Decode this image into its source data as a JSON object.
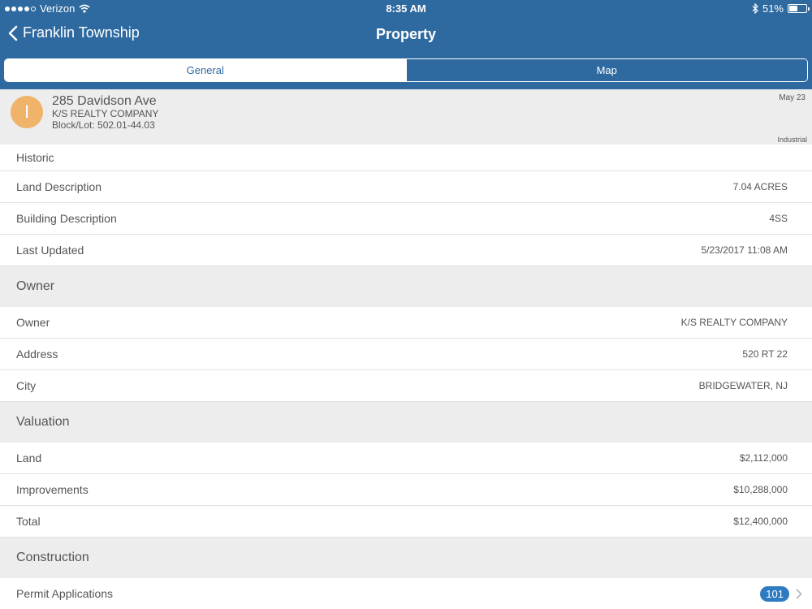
{
  "status_bar": {
    "carrier": "Verizon",
    "time": "8:35 AM",
    "battery": "51%",
    "battery_level": 0.51,
    "wifi_icon": "wifi-icon",
    "bluetooth_icon": "bluetooth-icon"
  },
  "nav": {
    "back_label": "Franklin Township",
    "title": "Property"
  },
  "tabs": [
    {
      "label": "General",
      "active": true
    },
    {
      "label": "Map",
      "active": false
    }
  ],
  "property": {
    "avatar_letter": "I",
    "address": "285 Davidson Ave",
    "owner": "K/S REALTY COMPANY",
    "block_lot": "Block/Lot: 502.01-44.03",
    "date": "May 23",
    "type": "Industrial"
  },
  "general_rows": [
    {
      "label": "Historic",
      "value": ""
    },
    {
      "label": "Land Description",
      "value": "7.04 ACRES"
    },
    {
      "label": "Building Description",
      "value": "4SS"
    },
    {
      "label": "Last Updated",
      "value": "5/23/2017 11:08 AM"
    }
  ],
  "owner_section": {
    "title": "Owner",
    "rows": [
      {
        "label": "Owner",
        "value": "K/S REALTY COMPANY"
      },
      {
        "label": "Address",
        "value": "520 RT 22"
      },
      {
        "label": "City",
        "value": "BRIDGEWATER, NJ"
      }
    ]
  },
  "valuation_section": {
    "title": "Valuation",
    "rows": [
      {
        "label": "Land",
        "value": "$2,112,000"
      },
      {
        "label": "Improvements",
        "value": "$10,288,000"
      },
      {
        "label": "Total",
        "value": "$12,400,000"
      }
    ]
  },
  "construction_section": {
    "title": "Construction",
    "rows": [
      {
        "label": "Permit Applications",
        "badge": "101"
      }
    ]
  },
  "colors": {
    "header_bg": "#2e6aa0",
    "section_bg": "#ededed",
    "avatar_bg": "#f0b36a",
    "badge_bg": "#2e7bc2"
  }
}
